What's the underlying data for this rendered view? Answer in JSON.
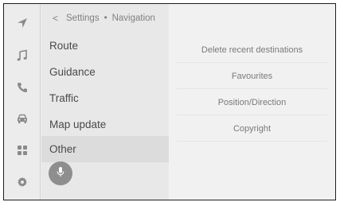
{
  "rail": {
    "items": [
      {
        "icon": "navigation-arrow-icon"
      },
      {
        "icon": "music-note-icon"
      },
      {
        "icon": "phone-icon"
      },
      {
        "icon": "car-icon"
      },
      {
        "icon": "apps-grid-icon"
      },
      {
        "icon": "gear-icon"
      }
    ]
  },
  "breadcrumb": {
    "back_icon": "chevron-left-icon",
    "parent": "Settings",
    "separator": "•",
    "current": "Navigation"
  },
  "menu": {
    "items": [
      {
        "label": "Route"
      },
      {
        "label": "Guidance"
      },
      {
        "label": "Traffic"
      },
      {
        "label": "Map update"
      },
      {
        "label": "Other",
        "selected": true
      }
    ]
  },
  "voice_button": {
    "icon": "microphone-icon"
  },
  "options": [
    {
      "label": "Delete recent destinations"
    },
    {
      "label": "Favourites"
    },
    {
      "label": "Position/Direction"
    },
    {
      "label": "Copyright"
    }
  ],
  "colors": {
    "screen_bg": "#efefef",
    "menu_bg": "#e8e8e8",
    "selected_bg": "#dcdcdc",
    "icon_gray": "#8a8a8a",
    "mic_bg": "#8e8e8e"
  }
}
